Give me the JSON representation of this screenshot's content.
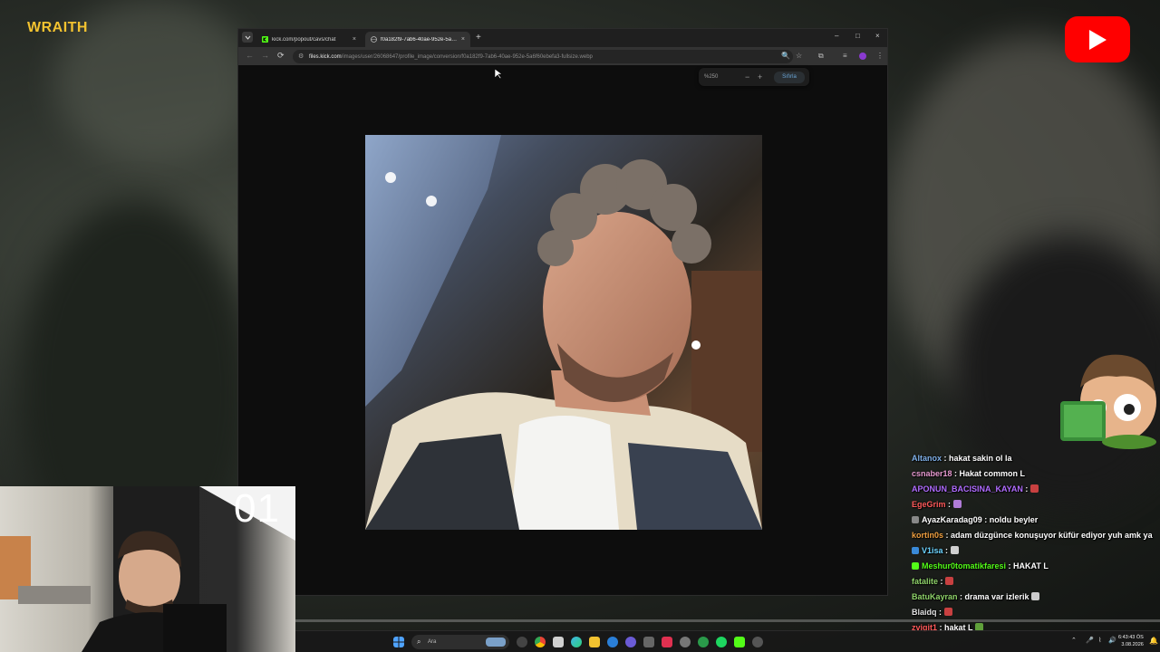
{
  "overlay": {
    "brand_logo_text": "WRAITH",
    "cam_counter": "01"
  },
  "browser": {
    "tabs": [
      {
        "title": "kick.com/popout/cavs/chat",
        "close": "×"
      },
      {
        "title": "f0a182f9-7ab6-40ae-952e-5a6f6",
        "close": "×"
      }
    ],
    "new_tab": "+",
    "window_controls": {
      "minimize": "–",
      "maximize": "□",
      "close": "×"
    },
    "nav": {
      "back": "←",
      "forward": "→",
      "reload": "⟳"
    },
    "url_host": "files.kick.com",
    "url_path": "/images/user/26068647/profile_image/conversion/f0a182f9-7ab6-40ae-952e-5a6f60ebefa3-fullsize.webp",
    "zoom": {
      "level": "%250",
      "minus": "−",
      "plus": "+",
      "reset": "Sıfırla"
    }
  },
  "chat": {
    "messages": [
      {
        "user": "Altanox",
        "text": "hakat sakin ol la",
        "color": "#7fb0e8"
      },
      {
        "user": "csnaber18",
        "text": "Hakat common L",
        "color": "#e79ad0"
      },
      {
        "user": "APONUN_BACISINA_KAYAN",
        "text": "",
        "color": "#b06cff",
        "emote": "#c84040"
      },
      {
        "user": "EgeGrim",
        "text": "",
        "color": "#ff5a5a",
        "emote": "#b07cd8"
      },
      {
        "user": "AyazKaradag09",
        "text": "noldu beyler",
        "color": "#ffffff",
        "badge": "#888888"
      },
      {
        "user": "kortin0s",
        "text": "adam düzgünce konuşuyor küfür ediyor yuh amk ya",
        "color": "#f0a040"
      },
      {
        "user": "V1isa",
        "text": "",
        "color": "#6cd4ff",
        "badge": "#3a8ad8",
        "emote": "#d0d0d0"
      },
      {
        "user": "Meshur0tomatikfaresi",
        "text": "HAKAT L",
        "color": "#53fc18",
        "badge": "#53fc18"
      },
      {
        "user": "fatalite",
        "text": "",
        "color": "#8fd36a",
        "emote": "#c84040"
      },
      {
        "user": "BatuKayran",
        "text": "drama var izlerik",
        "color": "#8fd36a",
        "emote": "#cccccc"
      },
      {
        "user": "Blaidq",
        "text": "",
        "color": "#e0e0e0",
        "emote": "#c84040"
      },
      {
        "user": "zvigit1",
        "text": "hakat L",
        "color": "#ff5a5a",
        "emote": "#5fa03a"
      }
    ]
  },
  "taskbar": {
    "search_placeholder": "Ara",
    "clock_time": "6:43:43 ÖS",
    "clock_date": "3.08.2026"
  },
  "colors": {
    "kick_green": "#53fc18",
    "youtube_red": "#ff0000",
    "wraith_gold": "#f2c230",
    "reset_blue": "#6aa6d8"
  }
}
